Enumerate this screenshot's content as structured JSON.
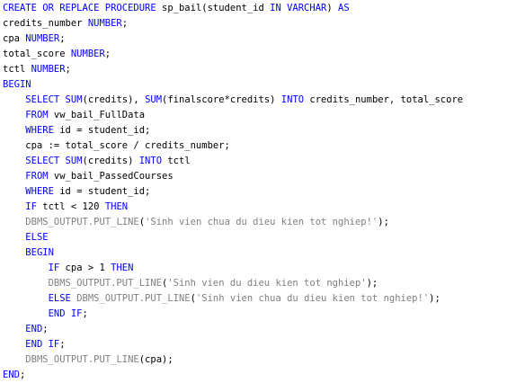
{
  "editor": {
    "language": "PL/SQL",
    "colors": {
      "keyword": "#0000ff",
      "builtin_dbms": "#808080",
      "string": "#808080",
      "plain": "#000000",
      "background": "#ffffff"
    },
    "lines": [
      [
        {
          "t": "kw",
          "v": "CREATE OR REPLACE PROCEDURE"
        },
        {
          "t": "txt",
          "v": " sp_bail(student_id "
        },
        {
          "t": "kw",
          "v": "IN VARCHAR"
        },
        {
          "t": "txt",
          "v": ") "
        },
        {
          "t": "kw",
          "v": "AS"
        }
      ],
      [
        {
          "t": "txt",
          "v": "credits_number "
        },
        {
          "t": "kw",
          "v": "NUMBER"
        },
        {
          "t": "txt",
          "v": ";"
        }
      ],
      [
        {
          "t": "txt",
          "v": "cpa "
        },
        {
          "t": "kw",
          "v": "NUMBER"
        },
        {
          "t": "txt",
          "v": ";"
        }
      ],
      [
        {
          "t": "txt",
          "v": "total_score "
        },
        {
          "t": "kw",
          "v": "NUMBER"
        },
        {
          "t": "txt",
          "v": ";"
        }
      ],
      [
        {
          "t": "txt",
          "v": "tctl "
        },
        {
          "t": "kw",
          "v": "NUMBER"
        },
        {
          "t": "txt",
          "v": ";"
        }
      ],
      [
        {
          "t": "kw",
          "v": "BEGIN"
        }
      ],
      [
        {
          "t": "txt",
          "v": "    "
        },
        {
          "t": "kw",
          "v": "SELECT SUM"
        },
        {
          "t": "txt",
          "v": "(credits), "
        },
        {
          "t": "kw",
          "v": "SUM"
        },
        {
          "t": "txt",
          "v": "(finalscore*credits) "
        },
        {
          "t": "kw",
          "v": "INTO"
        },
        {
          "t": "txt",
          "v": " credits_number, total_score"
        }
      ],
      [
        {
          "t": "txt",
          "v": "    "
        },
        {
          "t": "kw",
          "v": "FROM"
        },
        {
          "t": "txt",
          "v": " vw_bail_FullData"
        }
      ],
      [
        {
          "t": "txt",
          "v": "    "
        },
        {
          "t": "kw",
          "v": "WHERE"
        },
        {
          "t": "txt",
          "v": " id = student_id;"
        }
      ],
      [
        {
          "t": "txt",
          "v": "    cpa := total_score / credits_number;"
        }
      ],
      [
        {
          "t": "txt",
          "v": "    "
        },
        {
          "t": "kw",
          "v": "SELECT SUM"
        },
        {
          "t": "txt",
          "v": "(credits) "
        },
        {
          "t": "kw",
          "v": "INTO"
        },
        {
          "t": "txt",
          "v": " tctl"
        }
      ],
      [
        {
          "t": "txt",
          "v": "    "
        },
        {
          "t": "kw",
          "v": "FROM"
        },
        {
          "t": "txt",
          "v": " vw_bail_PassedCourses"
        }
      ],
      [
        {
          "t": "txt",
          "v": "    "
        },
        {
          "t": "kw",
          "v": "WHERE"
        },
        {
          "t": "txt",
          "v": " id = student_id;"
        }
      ],
      [
        {
          "t": "txt",
          "v": "    "
        },
        {
          "t": "kw",
          "v": "IF"
        },
        {
          "t": "txt",
          "v": " tctl < 120 "
        },
        {
          "t": "kw",
          "v": "THEN"
        }
      ],
      [
        {
          "t": "txt",
          "v": "    "
        },
        {
          "t": "fn",
          "v": "DBMS_OUTPUT.PUT_LINE"
        },
        {
          "t": "txt",
          "v": "("
        },
        {
          "t": "str",
          "v": "'Sinh vien chua du dieu kien tot nghiep!'"
        },
        {
          "t": "txt",
          "v": ");"
        }
      ],
      [
        {
          "t": "txt",
          "v": "    "
        },
        {
          "t": "kw",
          "v": "ELSE"
        }
      ],
      [
        {
          "t": "txt",
          "v": "    "
        },
        {
          "t": "kw",
          "v": "BEGIN"
        }
      ],
      [
        {
          "t": "txt",
          "v": "        "
        },
        {
          "t": "kw",
          "v": "IF"
        },
        {
          "t": "txt",
          "v": " cpa > 1 "
        },
        {
          "t": "kw",
          "v": "THEN"
        }
      ],
      [
        {
          "t": "txt",
          "v": "        "
        },
        {
          "t": "fn",
          "v": "DBMS_OUTPUT.PUT_LINE"
        },
        {
          "t": "txt",
          "v": "("
        },
        {
          "t": "str",
          "v": "'Sinh vien du dieu kien tot nghiep'"
        },
        {
          "t": "txt",
          "v": ");"
        }
      ],
      [
        {
          "t": "txt",
          "v": "        "
        },
        {
          "t": "kw",
          "v": "ELSE"
        },
        {
          "t": "txt",
          "v": " "
        },
        {
          "t": "fn",
          "v": "DBMS_OUTPUT.PUT_LINE"
        },
        {
          "t": "txt",
          "v": "("
        },
        {
          "t": "str",
          "v": "'Sinh vien chua du dieu kien tot nghiep!'"
        },
        {
          "t": "txt",
          "v": ");"
        }
      ],
      [
        {
          "t": "txt",
          "v": "        "
        },
        {
          "t": "kw",
          "v": "END IF"
        },
        {
          "t": "txt",
          "v": ";"
        }
      ],
      [
        {
          "t": "txt",
          "v": "    "
        },
        {
          "t": "kw",
          "v": "END"
        },
        {
          "t": "txt",
          "v": ";"
        }
      ],
      [
        {
          "t": "txt",
          "v": "    "
        },
        {
          "t": "kw",
          "v": "END IF"
        },
        {
          "t": "txt",
          "v": ";"
        }
      ],
      [
        {
          "t": "txt",
          "v": "    "
        },
        {
          "t": "fn",
          "v": "DBMS_OUTPUT.PUT_LINE"
        },
        {
          "t": "txt",
          "v": "(cpa);"
        }
      ],
      [
        {
          "t": "kw",
          "v": "END"
        },
        {
          "t": "txt",
          "v": ";"
        }
      ]
    ]
  }
}
